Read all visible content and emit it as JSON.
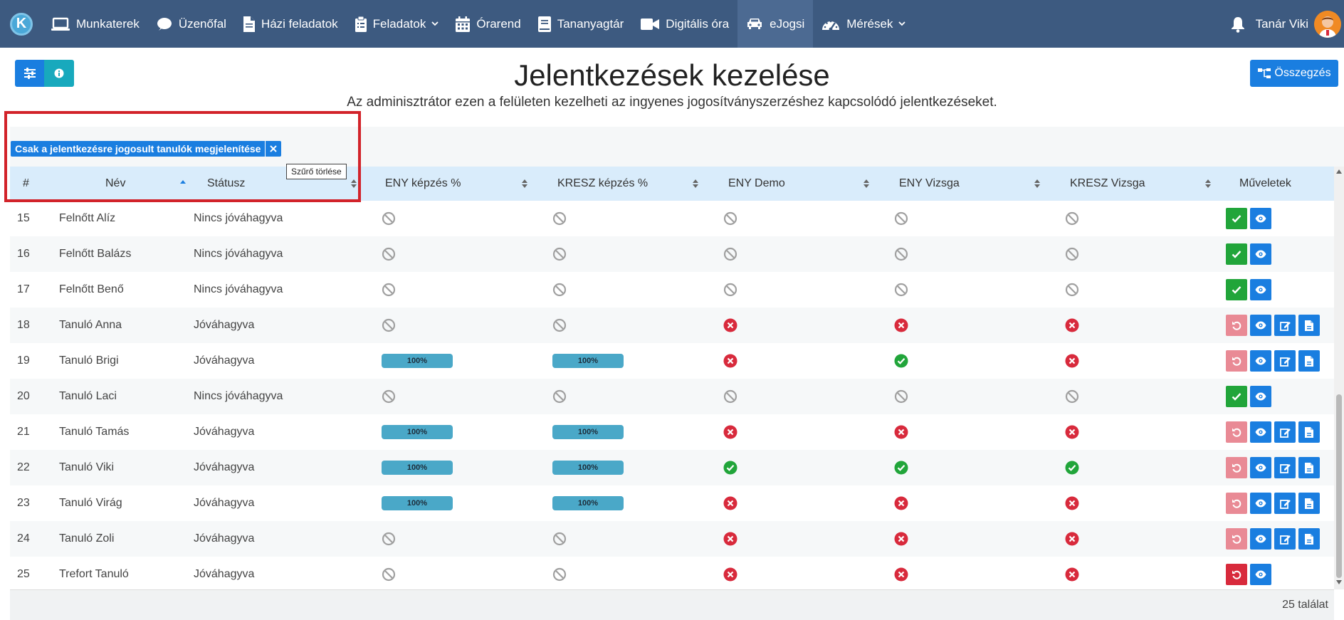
{
  "nav": {
    "brand_letter": "K",
    "items": [
      {
        "label": "Munkaterek",
        "icon": "laptop-icon"
      },
      {
        "label": "Üzenőfal",
        "icon": "chat-icon"
      },
      {
        "label": "Házi feladatok",
        "icon": "file-icon"
      },
      {
        "label": "Feladatok",
        "icon": "clipboard-icon",
        "dropdown": true
      },
      {
        "label": "Órarend",
        "icon": "calendar-icon"
      },
      {
        "label": "Tananyagtár",
        "icon": "book-icon"
      },
      {
        "label": "Digitális óra",
        "icon": "video-icon"
      },
      {
        "label": "eJogsi",
        "icon": "car-icon",
        "active": true
      },
      {
        "label": "Mérések",
        "icon": "gauge-icon",
        "dropdown": true
      }
    ],
    "user_name": "Tanár Viki"
  },
  "header": {
    "title": "Jelentkezések kezelése",
    "subtitle": "Az adminisztrátor ezen a felületen kezelheti az ingyenes jogosítványszerzéshez kapcsolódó jelentkezéseket.",
    "summary_label": "Összegzés"
  },
  "filter": {
    "chip_label": "Csak a jelentkezésre jogosult tanulók megjelenítése",
    "tooltip": "Szűrő törlése"
  },
  "table": {
    "columns": [
      "#",
      "Név",
      "Státusz",
      "ENY képzés %",
      "KRESZ képzés %",
      "ENY Demo",
      "ENY Vizsga",
      "KRESZ Vizsga",
      "Műveletek"
    ],
    "rows": [
      {
        "num": "15",
        "name": "Felnőtt Alíz",
        "status": "Nincs jóváhagyva",
        "eny": "none",
        "kresz": "none",
        "demo": "none",
        "vizsga": "none",
        "kv": "none",
        "ops": "approve"
      },
      {
        "num": "16",
        "name": "Felnőtt Balázs",
        "status": "Nincs jóváhagyva",
        "eny": "none",
        "kresz": "none",
        "demo": "none",
        "vizsga": "none",
        "kv": "none",
        "ops": "approve"
      },
      {
        "num": "17",
        "name": "Felnőtt Benő",
        "status": "Nincs jóváhagyva",
        "eny": "none",
        "kresz": "none",
        "demo": "none",
        "vizsga": "none",
        "kv": "none",
        "ops": "approve"
      },
      {
        "num": "18",
        "name": "Tanuló Anna",
        "status": "Jóváhagyva",
        "eny": "none",
        "kresz": "none",
        "demo": "fail",
        "vizsga": "fail",
        "kv": "fail",
        "ops": "full"
      },
      {
        "num": "19",
        "name": "Tanuló Brigi",
        "status": "Jóváhagyva",
        "eny": "100%",
        "kresz": "100%",
        "demo": "fail",
        "vizsga": "ok",
        "kv": "fail",
        "ops": "full"
      },
      {
        "num": "20",
        "name": "Tanuló Laci",
        "status": "Nincs jóváhagyva",
        "eny": "none",
        "kresz": "none",
        "demo": "none",
        "vizsga": "none",
        "kv": "none",
        "ops": "approve"
      },
      {
        "num": "21",
        "name": "Tanuló Tamás",
        "status": "Jóváhagyva",
        "eny": "100%",
        "kresz": "100%",
        "demo": "fail",
        "vizsga": "fail",
        "kv": "fail",
        "ops": "full"
      },
      {
        "num": "22",
        "name": "Tanuló Viki",
        "status": "Jóváhagyva",
        "eny": "100%",
        "kresz": "100%",
        "demo": "ok",
        "vizsga": "ok",
        "kv": "ok",
        "ops": "full"
      },
      {
        "num": "23",
        "name": "Tanuló Virág",
        "status": "Jóváhagyva",
        "eny": "100%",
        "kresz": "100%",
        "demo": "fail",
        "vizsga": "fail",
        "kv": "fail",
        "ops": "full"
      },
      {
        "num": "24",
        "name": "Tanuló Zoli",
        "status": "Jóváhagyva",
        "eny": "none",
        "kresz": "none",
        "demo": "fail",
        "vizsga": "fail",
        "kv": "fail",
        "ops": "full"
      },
      {
        "num": "25",
        "name": "Trefort Tanuló",
        "status": "Jóváhagyva",
        "eny": "none",
        "kresz": "none",
        "demo": "fail",
        "vizsga": "fail",
        "kv": "fail",
        "ops": "revoke"
      }
    ]
  },
  "footer": {
    "count_label": "25 találat"
  },
  "colors": {
    "navbar": "#3d5a80",
    "primary": "#1a7ee0",
    "success": "#21a53a",
    "danger": "#d82a3c",
    "header_row": "#d9ecfb",
    "highlight_box": "#d2232a"
  }
}
